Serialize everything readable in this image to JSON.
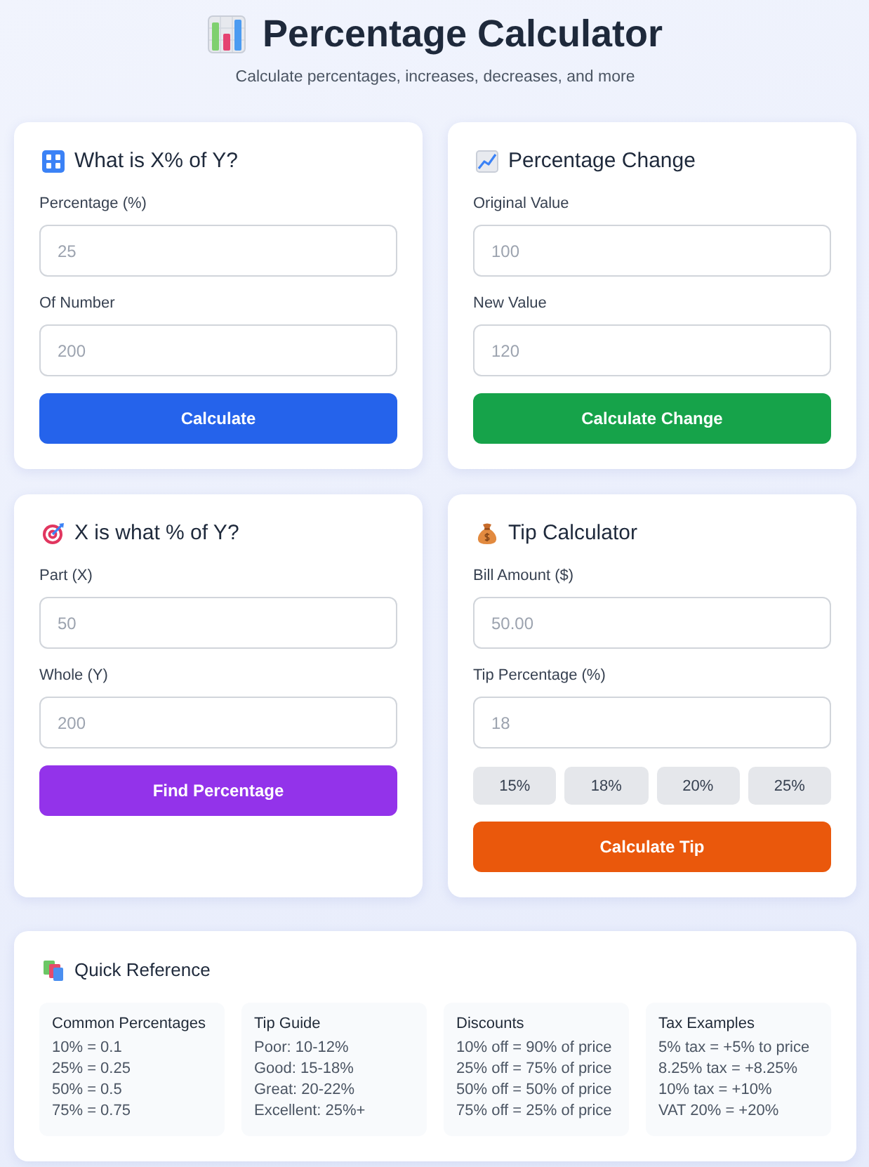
{
  "header": {
    "title": "Percentage Calculator",
    "subtitle": "Calculate percentages, increases, decreases, and more"
  },
  "calculators": [
    {
      "kind": "percent-of",
      "title": "What is X% of Y?",
      "fields": [
        {
          "label": "Percentage (%)",
          "placeholder": "25"
        },
        {
          "label": "Of Number",
          "placeholder": "200"
        }
      ],
      "button": "Calculate"
    },
    {
      "kind": "change",
      "title": "Percentage Change",
      "fields": [
        {
          "label": "Original Value",
          "placeholder": "100"
        },
        {
          "label": "New Value",
          "placeholder": "120"
        }
      ],
      "button": "Calculate Change"
    },
    {
      "kind": "ratio",
      "title": "X is what % of Y?",
      "fields": [
        {
          "label": "Part (X)",
          "placeholder": "50"
        },
        {
          "label": "Whole (Y)",
          "placeholder": "200"
        }
      ],
      "button": "Find Percentage"
    },
    {
      "kind": "tip",
      "title": "Tip Calculator",
      "fields": [
        {
          "label": "Bill Amount ($)",
          "placeholder": "50.00"
        },
        {
          "label": "Tip Percentage (%)",
          "placeholder": "18"
        }
      ],
      "presets": [
        "15%",
        "18%",
        "20%",
        "25%"
      ],
      "button": "Calculate Tip"
    }
  ],
  "reference": {
    "title": "Quick Reference",
    "groups": [
      {
        "title": "Common Percentages",
        "items": [
          "10% = 0.1",
          "25% = 0.25",
          "50% = 0.5",
          "75% = 0.75"
        ]
      },
      {
        "title": "Tip Guide",
        "items": [
          "Poor: 10-12%",
          "Good: 15-18%",
          "Great: 20-22%",
          "Excellent: 25%+"
        ]
      },
      {
        "title": "Discounts",
        "items": [
          "10% off = 90% of price",
          "25% off = 75% of price",
          "50% off = 50% of price",
          "75% off = 25% of price"
        ]
      },
      {
        "title": "Tax Examples",
        "items": [
          "5% tax = +5% to price",
          "8.25% tax = +8.25%",
          "10% tax = +10%",
          "VAT 20% = +20%"
        ]
      }
    ]
  }
}
